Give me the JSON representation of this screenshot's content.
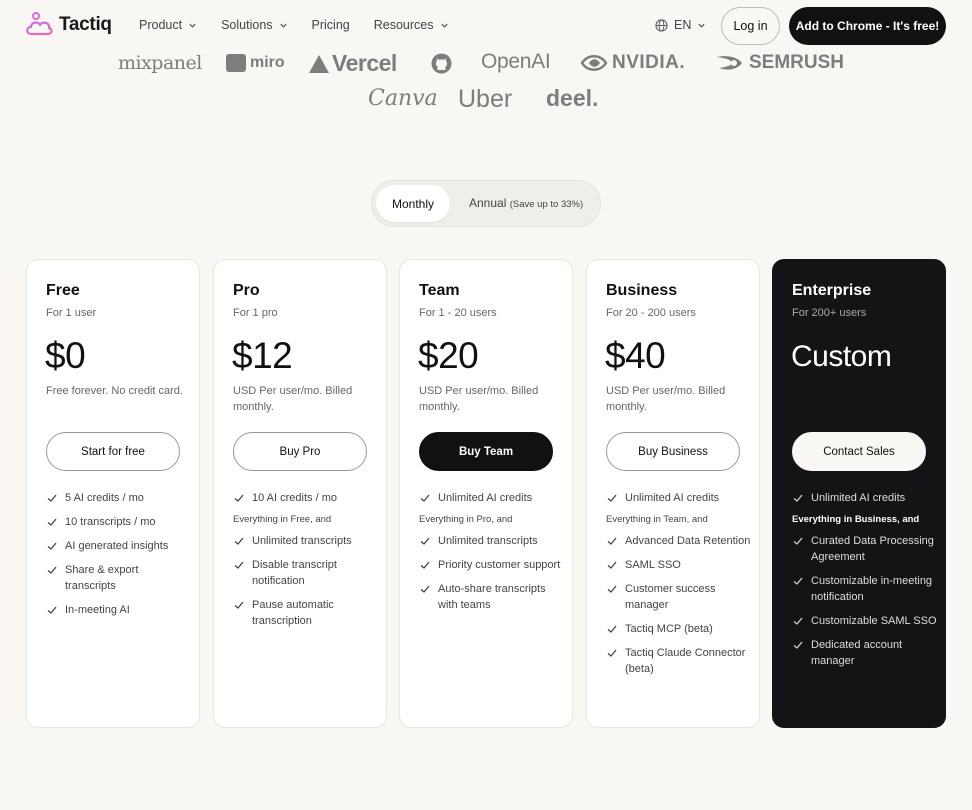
{
  "nav": {
    "brand": "Tactiq",
    "menu": [
      "Product",
      "Solutions",
      "Pricing",
      "Resources"
    ],
    "menu_has_dropdown": [
      true,
      true,
      false,
      true
    ],
    "language": "EN",
    "login": "Log in",
    "cta": "Add to Chrome - It's free!"
  },
  "logos": {
    "mixpanel": "mixpanel",
    "miro": "miro",
    "vercel": "Vercel",
    "openai": "OpenAI",
    "nvidia": "NVIDIA.",
    "semrush": "SEMRUSH",
    "canva": "Canva",
    "uber": "Uber",
    "deel": "deel."
  },
  "billing": {
    "monthly": "Monthly",
    "annual": "Annual",
    "annual_note": "(Save up to 33%)",
    "selected": "Monthly"
  },
  "plans": [
    {
      "name": "Free",
      "sub": "For 1 user",
      "price": "$0",
      "desc": "Free forever. No credit card.",
      "button": "Start for free",
      "features_pre": [
        "5 AI credits / mo",
        "10 transcripts / mo",
        "AI generated insights",
        "Share & export transcripts",
        "In-meeting AI"
      ],
      "heading": "",
      "features": []
    },
    {
      "name": "Pro",
      "sub": "For 1 pro",
      "price": "$12",
      "desc": "USD Per user/mo. Billed monthly.",
      "button": "Buy Pro",
      "features_pre": [
        "10 AI credits / mo"
      ],
      "heading": "Everything in Free, and",
      "features": [
        "Unlimited transcripts",
        "Disable transcript notification",
        "Pause automatic transcription"
      ]
    },
    {
      "name": "Team",
      "sub": "For 1 - 20 users",
      "price": "$20",
      "desc": "USD Per user/mo. Billed monthly.",
      "button": "Buy Team",
      "features_pre": [
        "Unlimited AI credits"
      ],
      "heading": "Everything in Pro, and",
      "features": [
        "Unlimited transcripts",
        "Priority customer support",
        "Auto-share transcripts with teams"
      ]
    },
    {
      "name": "Business",
      "sub": "For 20 - 200 users",
      "price": "$40",
      "desc": "USD Per user/mo. Billed monthly.",
      "button": "Buy Business",
      "features_pre": [
        "Unlimited AI credits"
      ],
      "heading": "Everything in Team, and",
      "features": [
        "Advanced Data Retention",
        "SAML SSO",
        "Customer success manager",
        "Tactiq MCP (beta)",
        "Tactiq Claude Connector (beta)"
      ]
    },
    {
      "name": "Enterprise",
      "sub": "For 200+ users",
      "price": "Custom",
      "desc": "",
      "button": "Contact Sales",
      "features_pre": [
        "Unlimited AI credits"
      ],
      "heading": "Everything in Business, and",
      "features": [
        "Curated Data Processing Agreement",
        "Customizable in-meeting notification",
        "Customizable SAML SSO",
        "Dedicated account manager"
      ]
    }
  ]
}
